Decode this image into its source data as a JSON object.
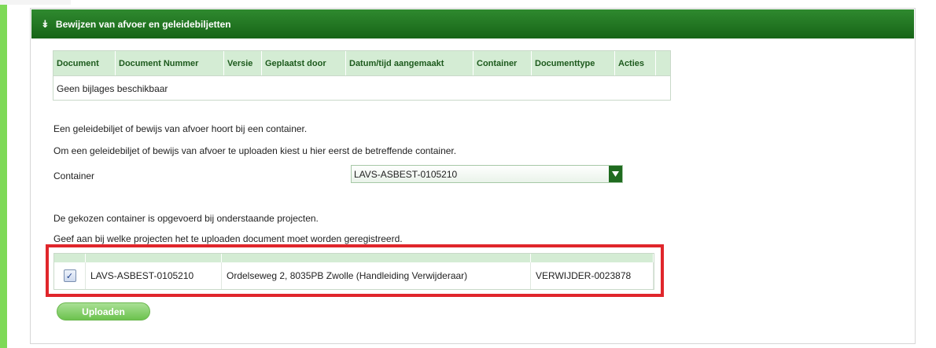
{
  "section": {
    "title": "Bewijzen van afvoer en geleidebiljetten",
    "collapse_icon": "chevron-double-down-icon"
  },
  "documents_table": {
    "columns": [
      "Document",
      "Document Nummer",
      "Versie",
      "Geplaatst door",
      "Datum/tijd aangemaakt",
      "Container",
      "Documenttype",
      "Acties"
    ],
    "empty_message": "Geen bijlages beschikbaar"
  },
  "container_info": {
    "line1": "Een geleidebiljet of bewijs van afvoer hoort bij een container.",
    "line2": "Om een geleidebiljet of bewijs van afvoer te uploaden kiest u hier eerst de betreffende container.",
    "label": "Container",
    "selected": "LAVS-ASBEST-0105210"
  },
  "projects_info": {
    "line1": "De gekozen container is opgevoerd bij onderstaande projecten.",
    "line2": "Geef aan bij welke projecten het te uploaden document moet worden geregistreerd."
  },
  "projects_table": {
    "rows": [
      {
        "checked": true,
        "container": "LAVS-ASBEST-0105210",
        "address": "Ordelseweg 2, 8035PB Zwolle (Handleiding Verwijderaar)",
        "project": "VERWIJDER-0023878"
      }
    ]
  },
  "actions": {
    "upload_label": "Uploaden"
  },
  "colors": {
    "header_green": "#176517",
    "accent_light_green": "#7ed957",
    "highlight_red": "#e0262b"
  }
}
